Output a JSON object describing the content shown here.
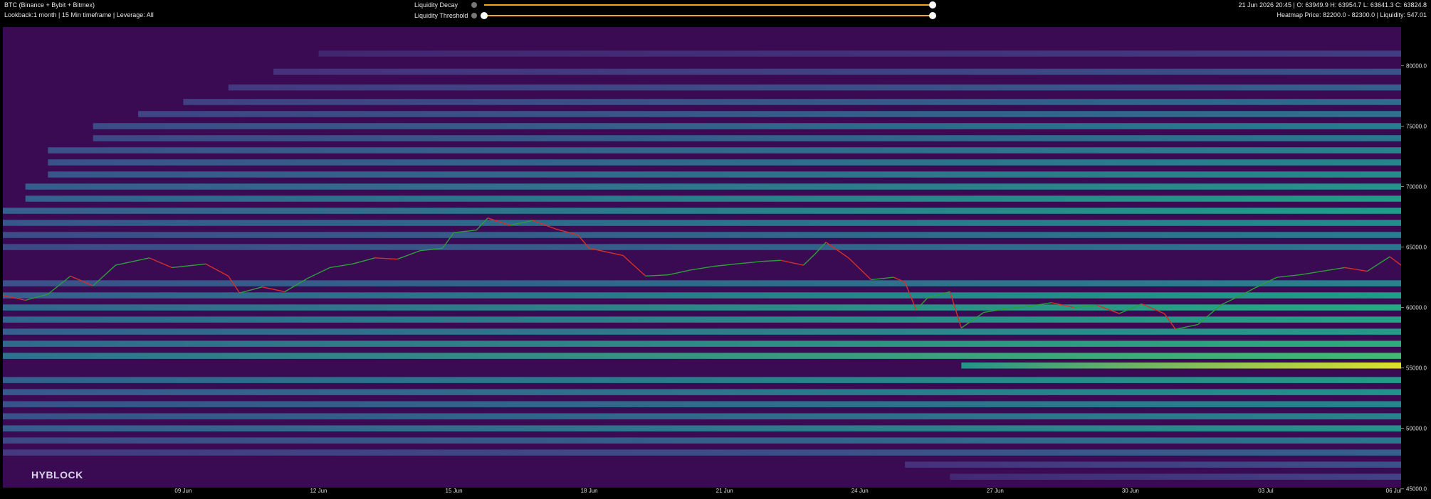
{
  "header": {
    "title": "BTC (Binance + Bybit + Bitmex)",
    "subtitle": "Lookback:1 month | 15 Min timeframe | Leverage: All",
    "ohlc": "21 Jun 2026 20:45 | O: 63949.9 H: 63954.7 L: 63641.3 C: 63824.8",
    "heatmap_info": "Heatmap Price: 82200.0 - 82300.0 | Liquidity: 547.01"
  },
  "controls": {
    "decay_label": "Liquidity Decay",
    "threshold_label": "Liquidity Threshold",
    "decay_value": 1.0,
    "threshold_value": 0.0,
    "accent_color": "#f2a71e"
  },
  "brand": "HYBLOCK",
  "colors": {
    "background": "#3a0b52",
    "price_up": "#2e9e3a",
    "price_down": "#d5302a"
  },
  "chart_data": {
    "type": "heatmap",
    "x_start": "2026-06-05 00:00",
    "x_end": "2026-07-06 00:00",
    "x_ticks": [
      {
        "date": "2026-06-09",
        "label": "09 Jun"
      },
      {
        "date": "2026-06-12",
        "label": "12 Jun"
      },
      {
        "date": "2026-06-15",
        "label": "15 Jun"
      },
      {
        "date": "2026-06-18",
        "label": "18 Jun"
      },
      {
        "date": "2026-06-21",
        "label": "21 Jun"
      },
      {
        "date": "2026-06-24",
        "label": "24 Jun"
      },
      {
        "date": "2026-06-27",
        "label": "27 Jun"
      },
      {
        "date": "2026-06-30",
        "label": "30 Jun"
      },
      {
        "date": "2026-07-03",
        "label": "03 Jul"
      },
      {
        "date": "2026-07-06",
        "label": "06 Jul"
      }
    ],
    "ylim": [
      45100,
      83200
    ],
    "y_ticks": [
      {
        "value": 80000,
        "label": "80000.0"
      },
      {
        "value": 75000,
        "label": "75000.0"
      },
      {
        "value": 70000,
        "label": "70000.0"
      },
      {
        "value": 65000,
        "label": "65000.0"
      },
      {
        "value": 60000,
        "label": "60000.0"
      },
      {
        "value": 55000,
        "label": "55000.0"
      },
      {
        "value": 50000,
        "label": "50000.0"
      },
      {
        "value": 45000,
        "label": "45000.0"
      }
    ],
    "colorscale": [
      "#3a0b52",
      "#46327e",
      "#365c8d",
      "#277f8e",
      "#1fa187",
      "#4ac16d",
      "#a0da39",
      "#fde725"
    ],
    "price_series": [
      {
        "date": "2026-06-05 00:00",
        "price": 61000
      },
      {
        "date": "2026-06-05 12:00",
        "price": 60600
      },
      {
        "date": "2026-06-06 00:00",
        "price": 61100
      },
      {
        "date": "2026-06-06 12:00",
        "price": 62600
      },
      {
        "date": "2026-06-07 00:00",
        "price": 61800
      },
      {
        "date": "2026-06-07 12:00",
        "price": 63500
      },
      {
        "date": "2026-06-08 06:00",
        "price": 64100
      },
      {
        "date": "2026-06-08 18:00",
        "price": 63300
      },
      {
        "date": "2026-06-09 12:00",
        "price": 63600
      },
      {
        "date": "2026-06-10 00:00",
        "price": 62600
      },
      {
        "date": "2026-06-10 06:00",
        "price": 61200
      },
      {
        "date": "2026-06-10 18:00",
        "price": 61700
      },
      {
        "date": "2026-06-11 06:00",
        "price": 61300
      },
      {
        "date": "2026-06-11 18:00",
        "price": 62400
      },
      {
        "date": "2026-06-12 06:00",
        "price": 63300
      },
      {
        "date": "2026-06-12 18:00",
        "price": 63600
      },
      {
        "date": "2026-06-13 06:00",
        "price": 64100
      },
      {
        "date": "2026-06-13 18:00",
        "price": 64000
      },
      {
        "date": "2026-06-14 06:00",
        "price": 64700
      },
      {
        "date": "2026-06-14 18:00",
        "price": 64900
      },
      {
        "date": "2026-06-15 00:00",
        "price": 66200
      },
      {
        "date": "2026-06-15 12:00",
        "price": 66400
      },
      {
        "date": "2026-06-15 18:00",
        "price": 67400
      },
      {
        "date": "2026-06-16 06:00",
        "price": 66800
      },
      {
        "date": "2026-06-16 18:00",
        "price": 67200
      },
      {
        "date": "2026-06-17 06:00",
        "price": 66500
      },
      {
        "date": "2026-06-17 18:00",
        "price": 66000
      },
      {
        "date": "2026-06-18 00:00",
        "price": 64900
      },
      {
        "date": "2026-06-18 18:00",
        "price": 64300
      },
      {
        "date": "2026-06-19 06:00",
        "price": 62600
      },
      {
        "date": "2026-06-19 18:00",
        "price": 62700
      },
      {
        "date": "2026-06-20 06:00",
        "price": 63100
      },
      {
        "date": "2026-06-20 18:00",
        "price": 63400
      },
      {
        "date": "2026-06-21 06:00",
        "price": 63600
      },
      {
        "date": "2026-06-21 20:45",
        "price": 63824.8
      },
      {
        "date": "2026-06-22 06:00",
        "price": 63900
      },
      {
        "date": "2026-06-22 18:00",
        "price": 63500
      },
      {
        "date": "2026-06-23 00:00",
        "price": 64400
      },
      {
        "date": "2026-06-23 06:00",
        "price": 65400
      },
      {
        "date": "2026-06-23 18:00",
        "price": 64100
      },
      {
        "date": "2026-06-24 06:00",
        "price": 62300
      },
      {
        "date": "2026-06-24 18:00",
        "price": 62500
      },
      {
        "date": "2026-06-25 00:00",
        "price": 62100
      },
      {
        "date": "2026-06-25 06:00",
        "price": 59800
      },
      {
        "date": "2026-06-25 12:00",
        "price": 60800
      },
      {
        "date": "2026-06-26 00:00",
        "price": 61300
      },
      {
        "date": "2026-06-26 06:00",
        "price": 58300
      },
      {
        "date": "2026-06-26 18:00",
        "price": 59600
      },
      {
        "date": "2026-06-27 06:00",
        "price": 59900
      },
      {
        "date": "2026-06-27 18:00",
        "price": 60100
      },
      {
        "date": "2026-06-28 06:00",
        "price": 60400
      },
      {
        "date": "2026-06-28 18:00",
        "price": 60000
      },
      {
        "date": "2026-06-29 06:00",
        "price": 60200
      },
      {
        "date": "2026-06-29 18:00",
        "price": 59500
      },
      {
        "date": "2026-06-30 06:00",
        "price": 60300
      },
      {
        "date": "2026-06-30 18:00",
        "price": 59500
      },
      {
        "date": "2026-07-01 00:00",
        "price": 58200
      },
      {
        "date": "2026-07-01 12:00",
        "price": 58600
      },
      {
        "date": "2026-07-02 00:00",
        "price": 60200
      },
      {
        "date": "2026-07-02 12:00",
        "price": 61100
      },
      {
        "date": "2026-07-02 18:00",
        "price": 61600
      },
      {
        "date": "2026-07-03 06:00",
        "price": 62500
      },
      {
        "date": "2026-07-03 18:00",
        "price": 62700
      },
      {
        "date": "2026-07-04 06:00",
        "price": 63000
      },
      {
        "date": "2026-07-04 18:00",
        "price": 63300
      },
      {
        "date": "2026-07-05 06:00",
        "price": 63000
      },
      {
        "date": "2026-07-05 18:00",
        "price": 64200
      },
      {
        "date": "2026-07-06 00:00",
        "price": 63500
      }
    ],
    "liquidity_bands": [
      {
        "price": 81000,
        "intensity": 0.18,
        "from": "2026-06-12 00:00"
      },
      {
        "price": 79500,
        "intensity": 0.25,
        "from": "2026-06-11 00:00"
      },
      {
        "price": 78200,
        "intensity": 0.3,
        "from": "2026-06-10 00:00"
      },
      {
        "price": 77000,
        "intensity": 0.35,
        "from": "2026-06-09 00:00"
      },
      {
        "price": 76000,
        "intensity": 0.38,
        "from": "2026-06-08 00:00"
      },
      {
        "price": 75000,
        "intensity": 0.42,
        "from": "2026-06-07 00:00"
      },
      {
        "price": 74000,
        "intensity": 0.4,
        "from": "2026-06-07 00:00"
      },
      {
        "price": 73000,
        "intensity": 0.45,
        "from": "2026-06-06 00:00"
      },
      {
        "price": 72000,
        "intensity": 0.46,
        "from": "2026-06-06 00:00"
      },
      {
        "price": 71000,
        "intensity": 0.48,
        "from": "2026-06-06 00:00"
      },
      {
        "price": 70000,
        "intensity": 0.52,
        "from": "2026-06-05 12:00"
      },
      {
        "price": 69000,
        "intensity": 0.55,
        "from": "2026-06-05 12:00"
      },
      {
        "price": 68000,
        "intensity": 0.55,
        "from": "2026-06-05 00:00"
      },
      {
        "price": 67000,
        "intensity": 0.48,
        "from": "2026-06-05 00:00"
      },
      {
        "price": 66000,
        "intensity": 0.42,
        "from": "2026-06-05 00:00"
      },
      {
        "price": 65000,
        "intensity": 0.4,
        "from": "2026-06-05 00:00"
      },
      {
        "price": 62000,
        "intensity": 0.45,
        "from": "2026-06-05 00:00"
      },
      {
        "price": 61000,
        "intensity": 0.55,
        "from": "2026-06-05 00:00"
      },
      {
        "price": 60000,
        "intensity": 0.6,
        "from": "2026-06-05 00:00"
      },
      {
        "price": 59000,
        "intensity": 0.58,
        "from": "2026-06-05 00:00"
      },
      {
        "price": 58000,
        "intensity": 0.55,
        "from": "2026-06-05 00:00"
      },
      {
        "price": 57000,
        "intensity": 0.62,
        "from": "2026-06-05 00:00"
      },
      {
        "price": 56000,
        "intensity": 0.68,
        "from": "2026-06-05 00:00"
      },
      {
        "price": 55200,
        "intensity": 0.95,
        "from": "2026-06-26 06:00"
      },
      {
        "price": 54000,
        "intensity": 0.55,
        "from": "2026-06-05 00:00"
      },
      {
        "price": 53000,
        "intensity": 0.5,
        "from": "2026-06-05 00:00"
      },
      {
        "price": 52000,
        "intensity": 0.46,
        "from": "2026-06-05 00:00"
      },
      {
        "price": 51000,
        "intensity": 0.45,
        "from": "2026-06-05 00:00"
      },
      {
        "price": 50000,
        "intensity": 0.52,
        "from": "2026-06-05 00:00"
      },
      {
        "price": 49000,
        "intensity": 0.4,
        "from": "2026-06-05 00:00"
      },
      {
        "price": 48000,
        "intensity": 0.3,
        "from": "2026-06-05 00:00"
      },
      {
        "price": 47000,
        "intensity": 0.25,
        "from": "2026-06-25 00:00"
      },
      {
        "price": 46000,
        "intensity": 0.2,
        "from": "2026-06-26 00:00"
      }
    ]
  }
}
